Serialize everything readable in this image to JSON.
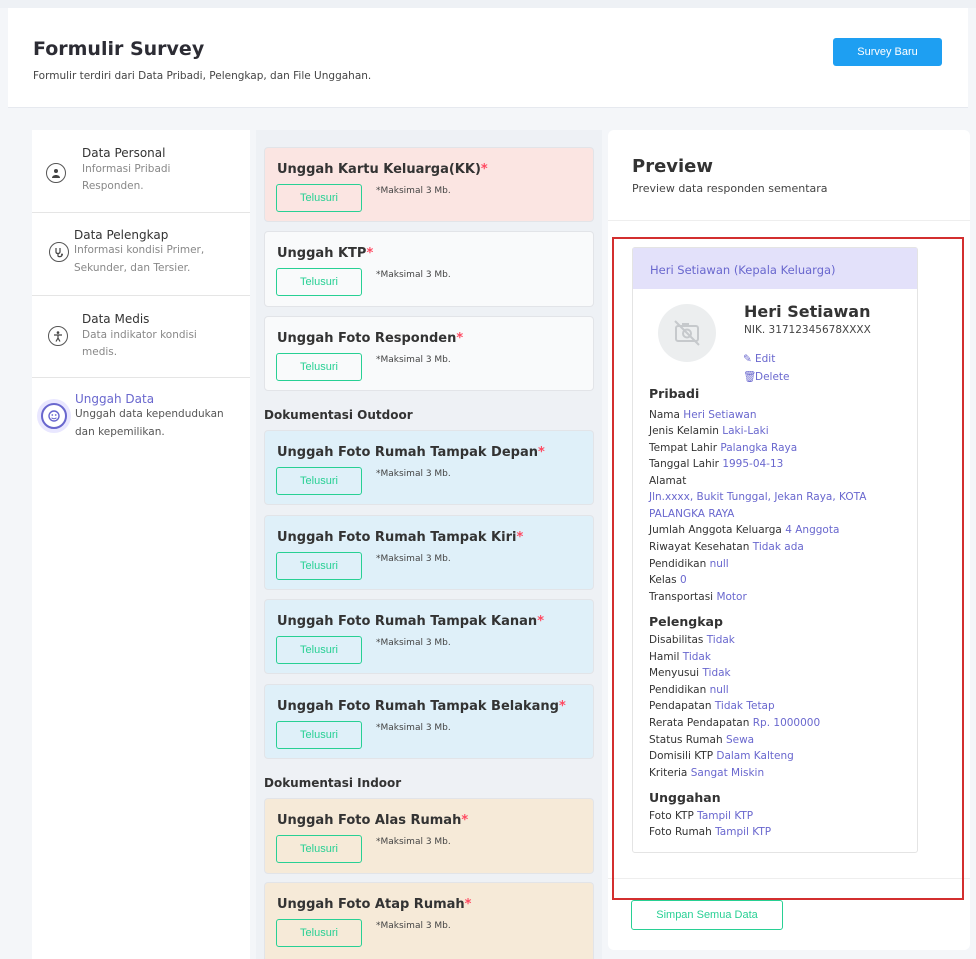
{
  "header": {
    "title": "Formulir Survey",
    "subtitle": "Formulir terdiri dari Data Pribadi, Pelengkap, dan File Unggahan.",
    "new_button": "Survey Baru"
  },
  "sidebar": {
    "items": [
      {
        "title": "Data Personal",
        "desc1": "Informasi Pribadi",
        "desc2": "Responden.",
        "icon": "user-icon"
      },
      {
        "title": "Data Pelengkap",
        "desc1": "Informasi kondisi Primer,",
        "desc2": "Sekunder, dan Tersier.",
        "icon": "stethoscope-icon"
      },
      {
        "title": "Data Medis",
        "desc1": "Data indikator kondisi",
        "desc2": "medis.",
        "icon": "accessibility-icon"
      },
      {
        "title": "Unggah Data",
        "desc1": "Unggah data kependudukan",
        "desc2": "dan kepemilikan.",
        "icon": "avatar-icon"
      }
    ]
  },
  "uploads": {
    "browse_label": "Telusuri",
    "note": "*Maksimal 3 Mb.",
    "required_mark": "*",
    "items": [
      {
        "title": "Unggah Kartu Keluarga(KK)"
      },
      {
        "title": "Unggah KTP"
      },
      {
        "title": "Unggah Foto Responden"
      },
      {
        "title": "Unggah Foto Rumah Tampak Depan"
      },
      {
        "title": "Unggah Foto Rumah Tampak Kiri"
      },
      {
        "title": "Unggah Foto Rumah Tampak Kanan"
      },
      {
        "title": "Unggah Foto Rumah Tampak Belakang"
      },
      {
        "title": "Unggah Foto Alas Rumah"
      },
      {
        "title": "Unggah Foto Atap Rumah"
      }
    ],
    "section_outdoor": "Dokumentasi Outdoor",
    "section_indoor": "Dokumentasi Indoor"
  },
  "preview": {
    "title": "Preview",
    "subtitle": "Preview data responden sementara",
    "card_header": "Heri Setiawan (Kepala Keluarga)",
    "name": "Heri Setiawan",
    "nik": "NIK. 31712345678XXXX",
    "edit": "Edit",
    "delete": "Delete",
    "pribadi_title": "Pribadi",
    "pribadi": [
      {
        "label": "Nama",
        "value": "Heri Setiawan"
      },
      {
        "label": "Jenis Kelamin",
        "value": "Laki-Laki"
      },
      {
        "label": "Tempat Lahir",
        "value": "Palangka Raya"
      },
      {
        "label": "Tanggal Lahir",
        "value": "1995-04-13"
      },
      {
        "label": "Alamat",
        "value": ""
      }
    ],
    "alamat_line1": "Jln.xxxx, Bukit Tunggal, Jekan Raya, KOTA",
    "alamat_line2": "PALANGKA RAYA",
    "pribadi2": [
      {
        "label": "Jumlah Anggota Keluarga",
        "value": "4 Anggota"
      },
      {
        "label": "Riwayat Kesehatan",
        "value": "Tidak ada"
      },
      {
        "label": "Pendidikan",
        "value": "null"
      },
      {
        "label": "Kelas",
        "value": "0"
      },
      {
        "label": "Transportasi",
        "value": "Motor"
      }
    ],
    "pelengkap_title": "Pelengkap",
    "pelengkap": [
      {
        "label": "Disabilitas",
        "value": "Tidak"
      },
      {
        "label": "Hamil",
        "value": "Tidak"
      },
      {
        "label": "Menyusui",
        "value": "Tidak"
      },
      {
        "label": "Pendidikan",
        "value": "null"
      },
      {
        "label": "Pendapatan",
        "value": "Tidak Tetap"
      },
      {
        "label": "Rerata Pendapatan",
        "value": "Rp. 1000000"
      },
      {
        "label": "Status Rumah",
        "value": "Sewa"
      },
      {
        "label": "Domisili KTP",
        "value": "Dalam Kalteng"
      },
      {
        "label": "Kriteria",
        "value": "Sangat Miskin"
      }
    ],
    "unggahan_title": "Unggahan",
    "unggahan": [
      {
        "label": "Foto KTP",
        "value": "Tampil KTP"
      },
      {
        "label": "Foto Rumah",
        "value": "Tampil KTP"
      }
    ],
    "save_button": "Simpan Semua Data"
  },
  "colors": {
    "accent": "#6967ce",
    "primary_button": "#1e9ff2",
    "success": "#28d094",
    "required": "#ff4961",
    "highlight_border": "#d32f2f"
  }
}
